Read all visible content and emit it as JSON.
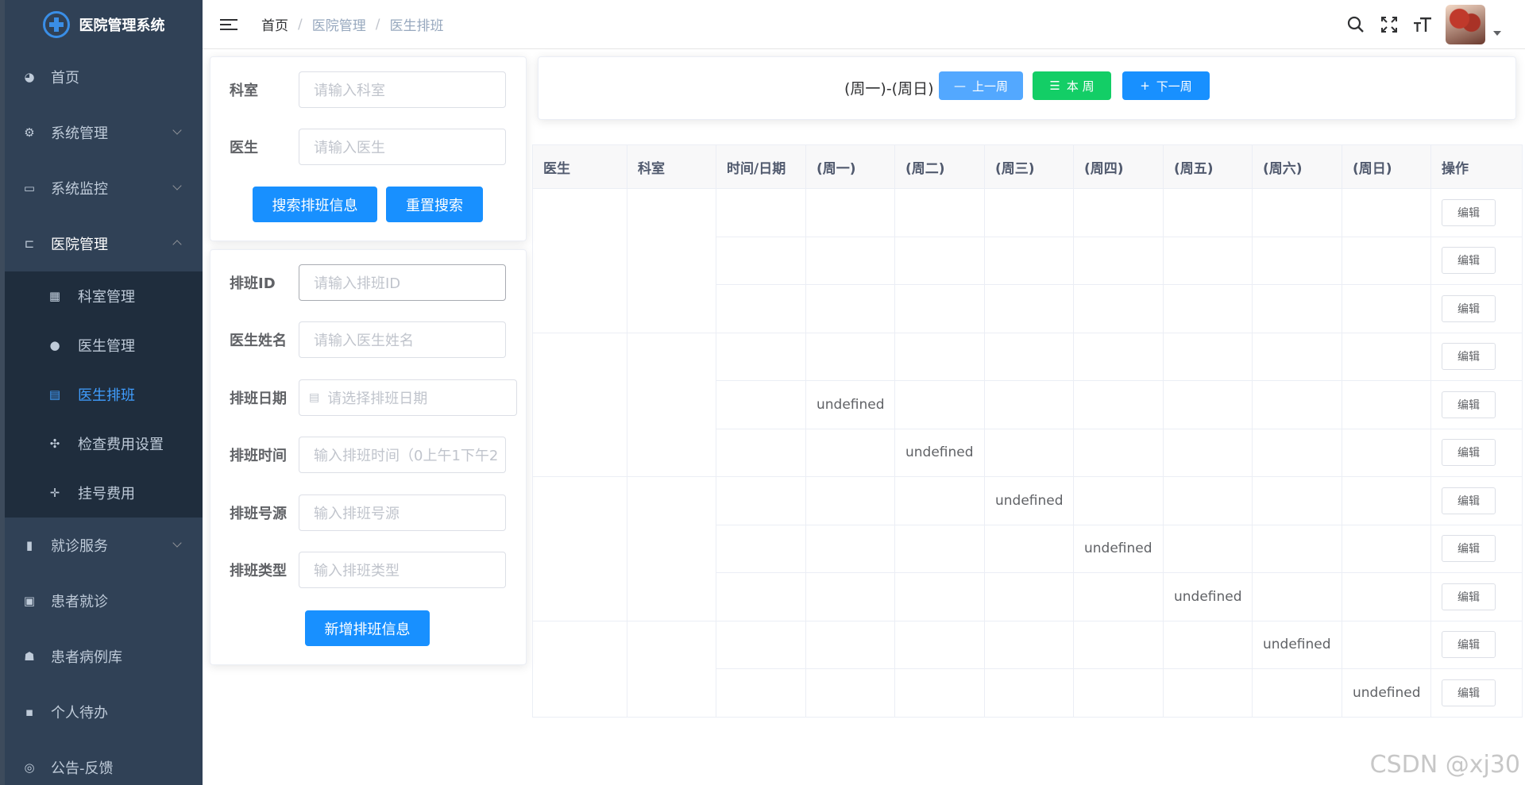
{
  "app": {
    "title": "医院管理系统"
  },
  "sidebar": {
    "items": [
      {
        "label": "首页",
        "icon": "dashboard-icon"
      },
      {
        "label": "系统管理",
        "icon": "gear-icon"
      },
      {
        "label": "系统监控",
        "icon": "monitor-icon"
      },
      {
        "label": "医院管理",
        "icon": "tree-icon"
      }
    ],
    "sub_items": [
      {
        "label": "科室管理",
        "icon": "grid-icon"
      },
      {
        "label": "医生管理",
        "icon": "user-icon"
      },
      {
        "label": "医生排班",
        "icon": "calendar-icon",
        "active": true
      },
      {
        "label": "检查费用设置",
        "icon": "compress-icon"
      },
      {
        "label": "挂号费用",
        "icon": "move-icon"
      }
    ],
    "bottom_items": [
      {
        "label": "就诊服务",
        "icon": "book-icon"
      },
      {
        "label": "患者就诊",
        "icon": "screen-icon"
      },
      {
        "label": "患者病例库",
        "icon": "people-icon"
      },
      {
        "label": "个人待办",
        "icon": "message-icon"
      },
      {
        "label": "公告-反馈",
        "icon": "wechat-icon"
      }
    ]
  },
  "header": {
    "breadcrumb": [
      "首页",
      "医院管理",
      "医生排班"
    ]
  },
  "search_form": {
    "dept_label": "科室",
    "dept_placeholder": "请输入科室",
    "doctor_label": "医生",
    "doctor_placeholder": "请输入医生",
    "search_button": "搜索排班信息",
    "reset_button": "重置搜索"
  },
  "add_form": {
    "id_label": "排班ID",
    "id_placeholder": "请输入排班ID",
    "name_label": "医生姓名",
    "name_placeholder": "请输入医生姓名",
    "date_label": "排班日期",
    "date_placeholder": "请选择排班日期",
    "time_label": "排班时间",
    "time_placeholder": "输入排班时间（0上午1下午2",
    "source_label": "排班号源",
    "source_placeholder": "输入排班号源",
    "type_label": "排班类型",
    "type_placeholder": "输入排班类型",
    "add_button": "新增排班信息"
  },
  "week_nav": {
    "range": "(周一)-(周日)",
    "prev_button": "上一周",
    "current_button": "本 周",
    "next_button": "下一周",
    "colors": {
      "prev": "#53a8ff",
      "current": "#13ce66",
      "next": "#1890ff"
    }
  },
  "table": {
    "headers": [
      "医生",
      "科室",
      "时间/日期",
      "(周一)",
      "(周二)",
      "(周三)",
      "(周四)",
      "(周五)",
      "(周六)",
      "(周日)",
      "操作"
    ],
    "edit_label": "编辑",
    "rows": [
      [
        "",
        "",
        "",
        "",
        "",
        "",
        ""
      ],
      [
        "",
        "",
        "",
        "",
        "",
        "",
        ""
      ],
      [
        "",
        "",
        "",
        "",
        "",
        "",
        ""
      ],
      [
        "",
        "",
        "",
        "",
        "",
        "",
        ""
      ],
      [
        "undefined",
        "",
        "",
        "",
        "",
        "",
        ""
      ],
      [
        "",
        "undefined",
        "",
        "",
        "",
        "",
        ""
      ],
      [
        "",
        "",
        "undefined",
        "",
        "",
        "",
        ""
      ],
      [
        "",
        "",
        "",
        "undefined",
        "",
        "",
        ""
      ],
      [
        "",
        "",
        "",
        "",
        "undefined",
        "",
        ""
      ],
      [
        "",
        "",
        "",
        "",
        "",
        "undefined",
        ""
      ],
      [
        "",
        "",
        "",
        "",
        "",
        "",
        "undefined"
      ]
    ]
  },
  "watermark": "CSDN @xj30"
}
